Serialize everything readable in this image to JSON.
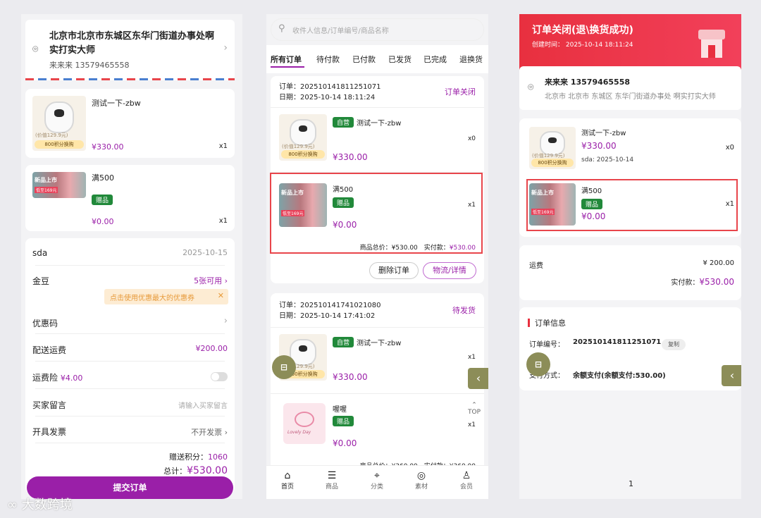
{
  "colors": {
    "accent": "#9a1fa8",
    "red": "#e8454b",
    "green": "#21893a",
    "fab": "#8c8d58"
  },
  "p1": {
    "address": {
      "line1": "北京市北京市东城区东华门街道办事处啊",
      "line2": "实打实大师",
      "contact": "来来来  13579465558"
    },
    "items": [
      {
        "name": "测试一下-zbw",
        "price": "¥330.00",
        "qty": "x1",
        "val": "(价值129.9元)",
        "pts": "800积分换购"
      },
      {
        "name": "满500",
        "tag": "赠品",
        "price": "¥0.00",
        "qty": "x1",
        "new": "新品上市",
        "lim": "低至169元"
      }
    ],
    "rows": [
      {
        "label": "sda",
        "value": "2025-10-15"
      },
      {
        "label": "金豆",
        "value": "5张可用 ›"
      },
      {
        "label": "优惠码",
        "value": "›"
      },
      {
        "label": "配送运费",
        "value": "¥200.00"
      },
      {
        "label": "运费险",
        "extra": "¥4.00"
      },
      {
        "label": "买家留言",
        "value": "请输入买家留言"
      },
      {
        "label": "开具发票",
        "value": "不开发票 ›"
      }
    ],
    "coupon_tip": "点击使用优惠最大的优惠券",
    "coupon_close": "✕",
    "bonus_label": "赠送积分：",
    "bonus_value": "1060",
    "total_label": "总计：",
    "total_value": "¥530.00",
    "submit": "提交订单"
  },
  "p2": {
    "search_placeholder": "收件人信息/订单编号/商品名称",
    "tabs": [
      "所有订单",
      "待付款",
      "已付款",
      "已发货",
      "已完成",
      "退换货"
    ],
    "order1": {
      "no": "订单：20251014181125107​1",
      "date": "日期：2025-10-14 18:11:24",
      "status": "订单关闭",
      "item1": {
        "tag": "自营",
        "name": "测试一下-zbw",
        "price": "¥330.00",
        "qty": "x0",
        "val": "(价值129.9元)",
        "pts": "800积分换购"
      },
      "item2": {
        "name": "满500",
        "tag": "赠品",
        "price": "¥0.00",
        "qty": "x1",
        "new": "新品上市",
        "lim": "低至169元"
      },
      "total": "商品总价：¥530.00　实付款：",
      "paid": "¥530.00",
      "btn_delete": "删除订单",
      "btn_logistics": "物流/详情"
    },
    "order2": {
      "no": "订单：202510141741021080",
      "date": "日期：2025-10-14 17:41:02",
      "status": "待发货",
      "item1": {
        "tag": "自营",
        "name": "测试一下-zbw",
        "price": "¥330.00",
        "qty": "x1",
        "val": "(价值129.9元)",
        "pts": "800积分换购"
      },
      "item2": {
        "name": "喔喔",
        "tag": "赠品",
        "price": "¥0.00",
        "qty": "x1",
        "brand": "Lovely Day"
      },
      "total": "商品总价：¥360.00　实付款：¥360.00"
    },
    "top": "TOP",
    "nav": [
      "首页",
      "商品",
      "分类",
      "素材",
      "会员"
    ]
  },
  "p3": {
    "banner_title": "订单关闭(退\\换货成功)",
    "banner_time": "创建时间：  2025-10-14 18:11:24",
    "contact": "来来来 13579465558",
    "address": "北京市 北京市 东城区 东华门街道办事处 啊实打实大师",
    "item1": {
      "name": "测试一下-zbw",
      "price": "¥330.00",
      "qty": "x0",
      "sda": "sda: 2025-10-14",
      "val": "(价值129.9元)",
      "pts": "800积分换购"
    },
    "item2": {
      "name": "满500",
      "tag": "赠品",
      "price": "¥0.00",
      "qty": "x1",
      "new": "新品上市",
      "lim": "低至169元"
    },
    "freight_label": "运费",
    "freight_value": "¥ 200.00",
    "paid_label": "实付款：",
    "paid_value": "¥530.00",
    "info_title": "订单信息",
    "order_no_label": "订单编号：",
    "order_no": "202510141811251071",
    "copy": "复制",
    "pay_label": "支付方式：",
    "pay_value": "余额支付(余额支付:530.00)",
    "page": "1"
  },
  "watermark": "大数跨境"
}
